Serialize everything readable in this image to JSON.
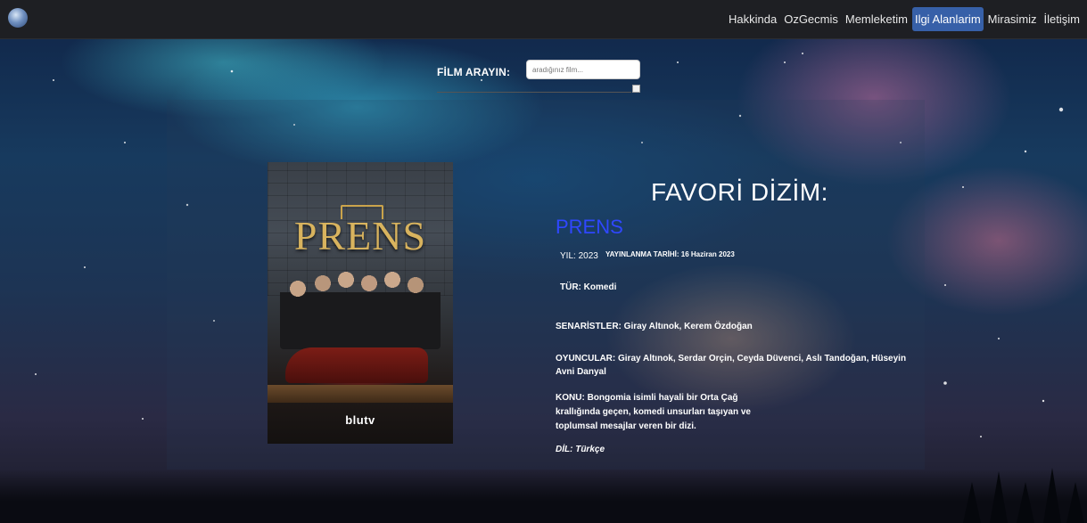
{
  "navbar": {
    "logo_icon": "globe-logo-icon",
    "links": [
      "Hakkinda",
      "OzGecmis",
      "Memleketim",
      "Ilgi Alanlarim",
      "Mirasimiz",
      "İletişim"
    ],
    "active_link": "Ilgi Alanlarim",
    "active_color": "#3760a8"
  },
  "search": {
    "label": "FİLM ARAYIN:",
    "placeholder": "aradığınız film..."
  },
  "poster": {
    "title": "PRENS",
    "brand": "blutv"
  },
  "series": {
    "heading": "FAVORİ DİZİM:",
    "title": "PRENS",
    "title_color": "#2f47ff",
    "year_label": "YIL:",
    "year": "2023",
    "release_label": "YAYINLANMA TARİHİ:",
    "release_date": "16 Haziran 2023",
    "genre_label": "TÜR:",
    "genre": "Komedi",
    "writers_label": "SENARİSTLER:",
    "writers": "Giray Altınok, Kerem Özdoğan",
    "cast_label": "OYUNCULAR:",
    "cast": "Giray Altınok, Serdar Orçin, Ceyda Düvenci, Aslı Tandoğan, Hüseyin Avni Danyal",
    "plot_label": "KONU:",
    "plot": "Bongomia isimli hayali bir Orta Çağ krallığında geçen, komedi unsurları taşıyan ve toplumsal mesajlar veren bir dizi.",
    "language_label": "DİL:",
    "language": "Türkçe"
  }
}
